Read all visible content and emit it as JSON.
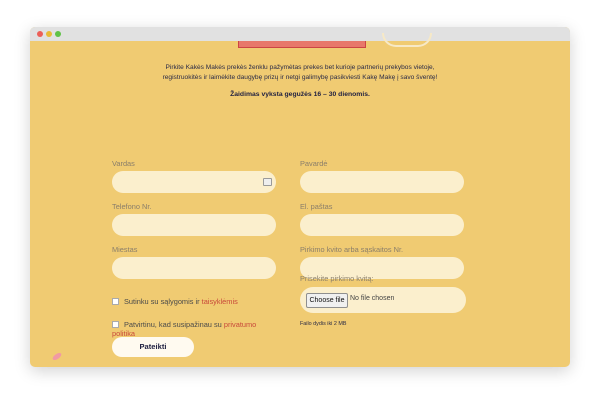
{
  "intro": {
    "line1": "Pirkite Kakės Makės prekės ženklu pažymėtas prekes bet kurioje partnerių prekybos vietoje,",
    "line2": "registruokitės ir laimėkite daugybę prizų ir netgi galimybę pasikviesti Kakę Makę į savo šventę!",
    "period": "Žaidimas vyksta gegužės 16 – 30 dienomis."
  },
  "form": {
    "first_name_label": "Vardas",
    "last_name_label": "Pavardė",
    "phone_label": "Telefono Nr.",
    "email_label": "El. paštas",
    "city_label": "Miestas",
    "receipt_label": "Pirkimo kvito arba sąskaitos Nr.",
    "attach_label": "Prisekite pirkimo kvitą:",
    "choose_file": "Choose file",
    "no_file": "No file chosen",
    "file_size": "Failo dydis iki 2 MB",
    "terms_text": "Sutinku su sąlygomis ir ",
    "terms_link": "taisyklėmis",
    "privacy_text": "Patvirtinu, kad susipažinau su ",
    "privacy_link_1": "privatumo",
    "privacy_link_2": "politika",
    "submit": "Pateikti"
  },
  "colors": {
    "background": "#f0cb72",
    "field": "#fbefcd",
    "link": "#c8493a",
    "text_dark": "#1f1f40"
  }
}
